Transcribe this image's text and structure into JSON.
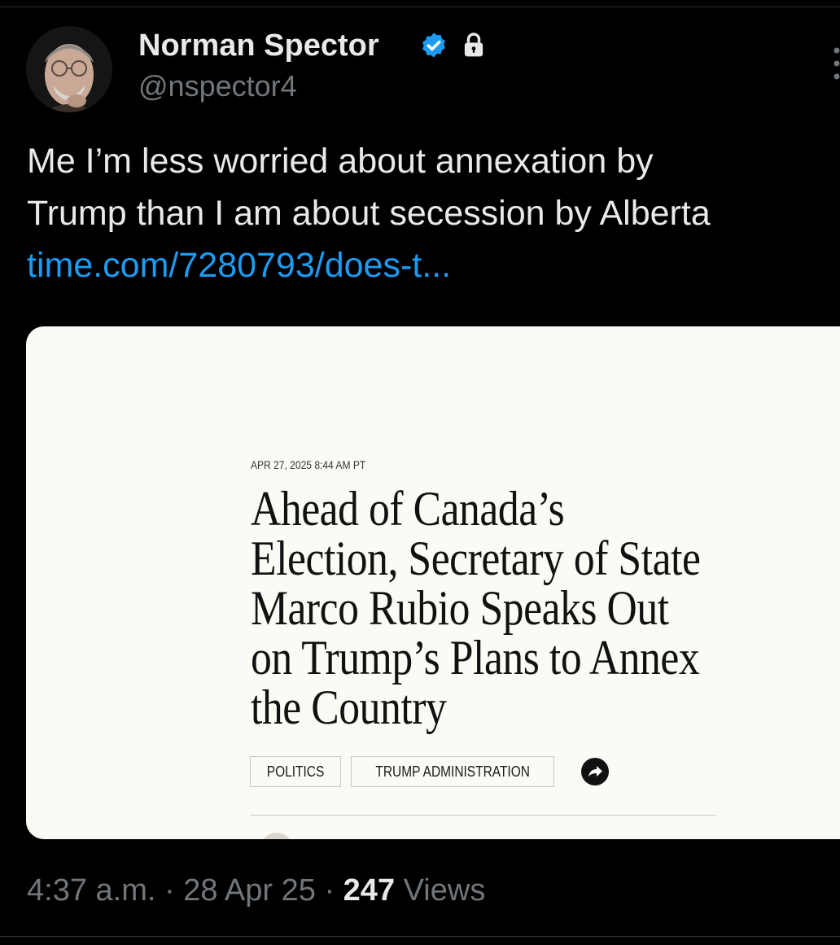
{
  "author": {
    "name": "Norman Spector",
    "handle": "@nspector4",
    "verified": true,
    "protected": true
  },
  "tweet": {
    "text_lines": [
      "Me I’m less worried about annexation by",
      "Trump than I am about secession by Alberta"
    ],
    "link_text": "time.com/7280793/does-t..."
  },
  "card": {
    "date": "APR 27, 2025 8:44 AM PT",
    "headline_lines": [
      "Ahead of Canada’s",
      "Election, Secretary of State",
      "Marco Rubio Speaks Out",
      "on Trump’s Plans to Annex",
      "the Country"
    ],
    "tags": [
      "POLITICS",
      "TRUMP ADMINISTRATION"
    ]
  },
  "meta": {
    "time": "4:37 a.m.",
    "separator": " · ",
    "date": "28 Apr 25",
    "views_count": "247",
    "views_label": " Views"
  },
  "colors": {
    "background": "#000000",
    "primary_text": "#e7e9ea",
    "secondary_text": "#71767b",
    "link": "#1d9bf0",
    "verified": "#1d9bf0",
    "card_background": "#fcfaf5"
  },
  "icons": {
    "verified": "verified-badge-icon",
    "protected": "lock-icon",
    "more": "more-vertical-icon",
    "share": "share-arrow-icon"
  }
}
